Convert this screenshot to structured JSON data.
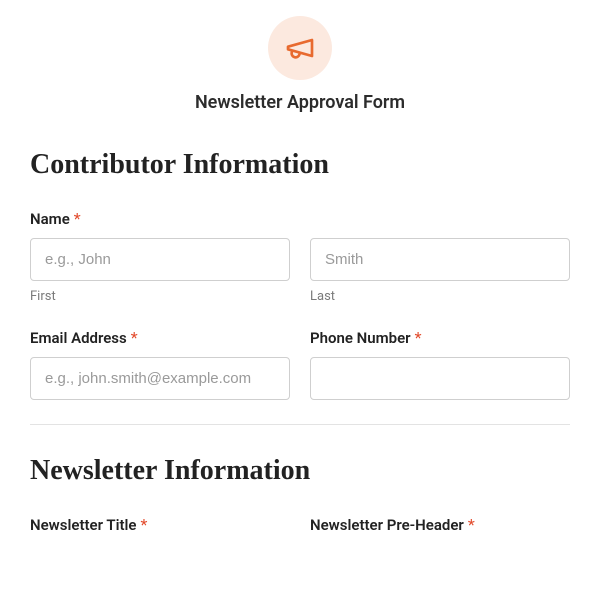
{
  "header": {
    "icon": "megaphone-icon",
    "title": "Newsletter Approval Form"
  },
  "section1": {
    "heading": "Contributor Information",
    "name": {
      "label": "Name",
      "required": "*",
      "first_placeholder": "e.g., John",
      "first_sublabel": "First",
      "last_placeholder": "Smith",
      "last_sublabel": "Last"
    },
    "email": {
      "label": "Email Address",
      "required": "*",
      "placeholder": "e.g., john.smith@example.com"
    },
    "phone": {
      "label": "Phone Number",
      "required": "*"
    }
  },
  "section2": {
    "heading": "Newsletter Information",
    "title_field": {
      "label": "Newsletter Title",
      "required": "*"
    },
    "preheader_field": {
      "label": "Newsletter Pre-Header",
      "required": "*"
    }
  }
}
